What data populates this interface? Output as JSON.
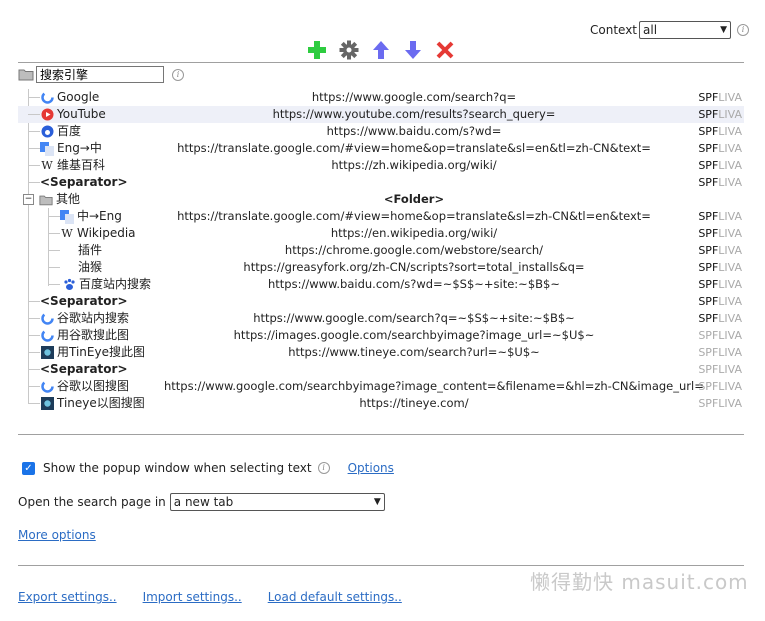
{
  "context": {
    "label": "Context",
    "value": "all"
  },
  "toolbar": {
    "add": "add-icon",
    "settings": "gear-icon",
    "up": "arrow-up-icon",
    "down": "arrow-down-icon",
    "delete": "delete-icon"
  },
  "root_name": "搜索引擎",
  "rows": [
    {
      "name": "Google",
      "url": "https://www.google.com/search?q=",
      "spf": "SPF",
      "liva": "LIVA",
      "icon": "google-icon"
    },
    {
      "name": "YouTube",
      "url": "https://www.youtube.com/results?search_query=",
      "spf": "SPF",
      "liva": "LIVA",
      "icon": "youtube-icon"
    },
    {
      "name": "百度",
      "url": "https://www.baidu.com/s?wd=",
      "spf": "SPF",
      "liva": "LIVA",
      "icon": "baidu-icon"
    },
    {
      "name": "Eng→中",
      "url": "https://translate.google.com/#view=home&op=translate&sl=en&tl=zh-CN&text=",
      "spf": "SPF",
      "liva": "LIVA",
      "icon": "translate-icon"
    },
    {
      "name": "维基百科",
      "url": "https://zh.wikipedia.org/wiki/",
      "spf": "SPF",
      "liva": "LIVA",
      "icon": "wikipedia-icon"
    },
    {
      "name": "<Separator>",
      "url": "",
      "spf": "SPF",
      "liva": "LIVA"
    },
    {
      "name": "其他",
      "url": "<Folder>",
      "spf": "",
      "liva": ""
    },
    {
      "name": "中→Eng",
      "url": "https://translate.google.com/#view=home&op=translate&sl=zh-CN&tl=en&text=",
      "spf": "SPF",
      "liva": "LIVA",
      "icon": "translate-icon"
    },
    {
      "name": "Wikipedia",
      "url": "https://en.wikipedia.org/wiki/",
      "spf": "SPF",
      "liva": "LIVA",
      "icon": "wikipedia-icon"
    },
    {
      "name": "插件",
      "url": "https://chrome.google.com/webstore/search/",
      "spf": "SPF",
      "liva": "LIVA"
    },
    {
      "name": "油猴",
      "url": "https://greasyfork.org/zh-CN/scripts?sort=total_installs&q=",
      "spf": "SPF",
      "liva": "LIVA"
    },
    {
      "name": "百度站内搜索",
      "url": "https://www.baidu.com/s?wd=~$S$~+site:~$B$~",
      "spf": "SPF",
      "liva": "LIVA",
      "icon": "baidu-icon"
    },
    {
      "name": "<Separator>",
      "url": "",
      "spf": "SPF",
      "liva": "LIVA"
    },
    {
      "name": "谷歌站内搜索",
      "url": "https://www.google.com/search?q=~$S$~+site:~$B$~",
      "spf": "SPF",
      "liva": "LIVA",
      "icon": "google-icon"
    },
    {
      "name": "用谷歌搜此图",
      "url": "https://images.google.com/searchbyimage?image_url=~$U$~",
      "spf": "SPF",
      "liva": "LIVA",
      "icon": "google-icon"
    },
    {
      "name": "用TinEye搜此图",
      "url": "https://www.tineye.com/search?url=~$U$~",
      "spf": "SPF",
      "liva": "LIVA",
      "icon": "tineye-icon"
    },
    {
      "name": "<Separator>",
      "url": "",
      "spf": "SPF",
      "liva": "LIVA"
    },
    {
      "name": "谷歌以图搜图",
      "url": "https://www.google.com/searchbyimage?image_content=&filename=&hl=zh-CN&image_url=",
      "spf": "SPF",
      "liva": "LIVA",
      "icon": "google-icon"
    },
    {
      "name": "Tineye以图搜图",
      "url": "https://tineye.com/",
      "spf": "SPF",
      "liva": "LIVA",
      "icon": "tineye-icon"
    }
  ],
  "options": {
    "popup_label": "Show the popup window when selecting text",
    "popup_checked": true,
    "options_link": "Options",
    "open_label": "Open the search page in",
    "open_value": "a new tab",
    "more_options": "More options"
  },
  "footer": {
    "export": "Export settings..",
    "import": "Import settings..",
    "load_default": "Load default settings.."
  },
  "watermark": "懒得勤快 masuit.com",
  "colors": {
    "add": "#2ecc40",
    "arrows": "#6b6bf0",
    "delete": "#e53935",
    "gear": "#666666",
    "link": "#2b6cc4"
  }
}
